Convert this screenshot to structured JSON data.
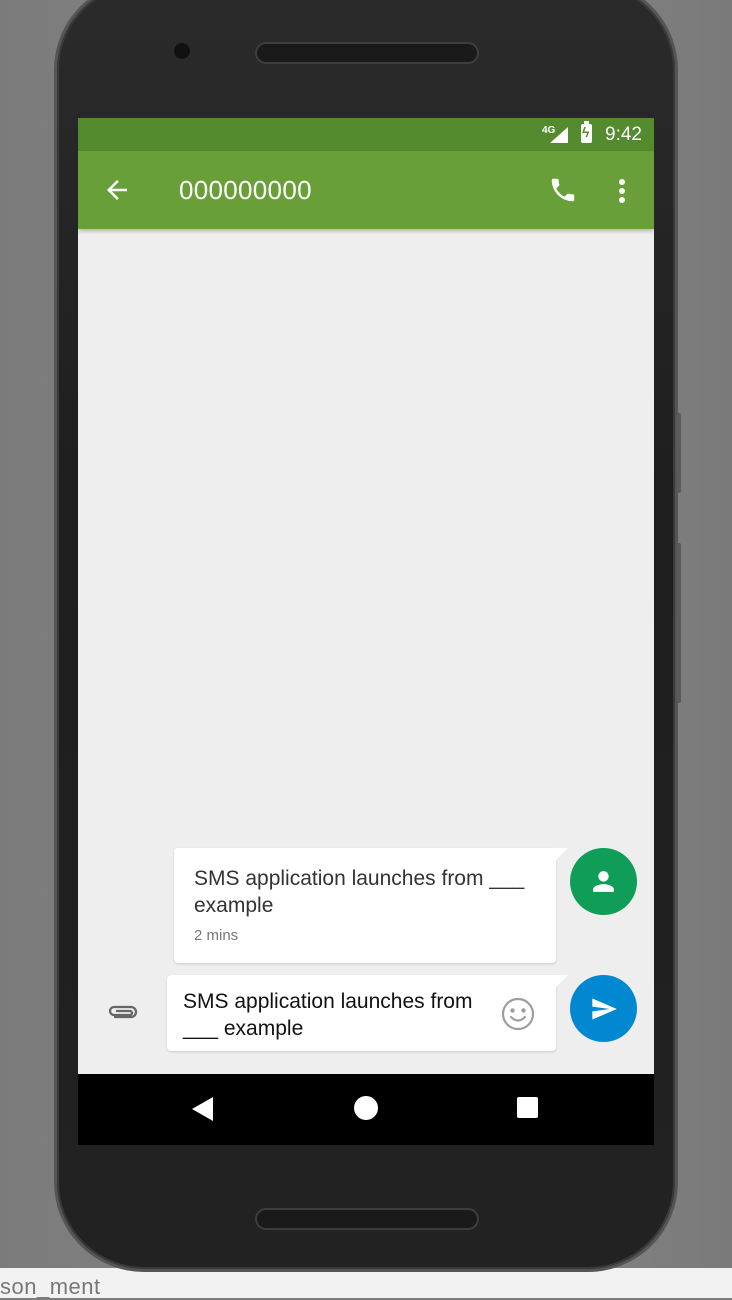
{
  "status_bar": {
    "network": "4G",
    "time": "9:42"
  },
  "app_bar": {
    "title": "000000000",
    "back_icon": "arrow-back-icon",
    "call_icon": "phone-icon",
    "menu_icon": "more-vert-icon"
  },
  "conversation": {
    "messages": [
      {
        "text": "SMS application launches from ___ example",
        "time": "2 mins",
        "avatar_icon": "person-icon"
      }
    ]
  },
  "compose": {
    "value": "SMS application launches from ___ example",
    "attach_icon": "paperclip-icon",
    "emoji_icon": "smiley-icon",
    "send_icon": "send-icon"
  },
  "navigation": {
    "back_icon": "nav-back-icon",
    "home_icon": "nav-home-icon",
    "recent_icon": "nav-recent-icon"
  },
  "background": {
    "text": "son_ment"
  },
  "colors": {
    "status_bar": "#558b2f",
    "app_bar": "#689f38",
    "avatar": "#0f9d58",
    "send_button": "#0288d1",
    "screen_bg": "#eeeeee"
  }
}
